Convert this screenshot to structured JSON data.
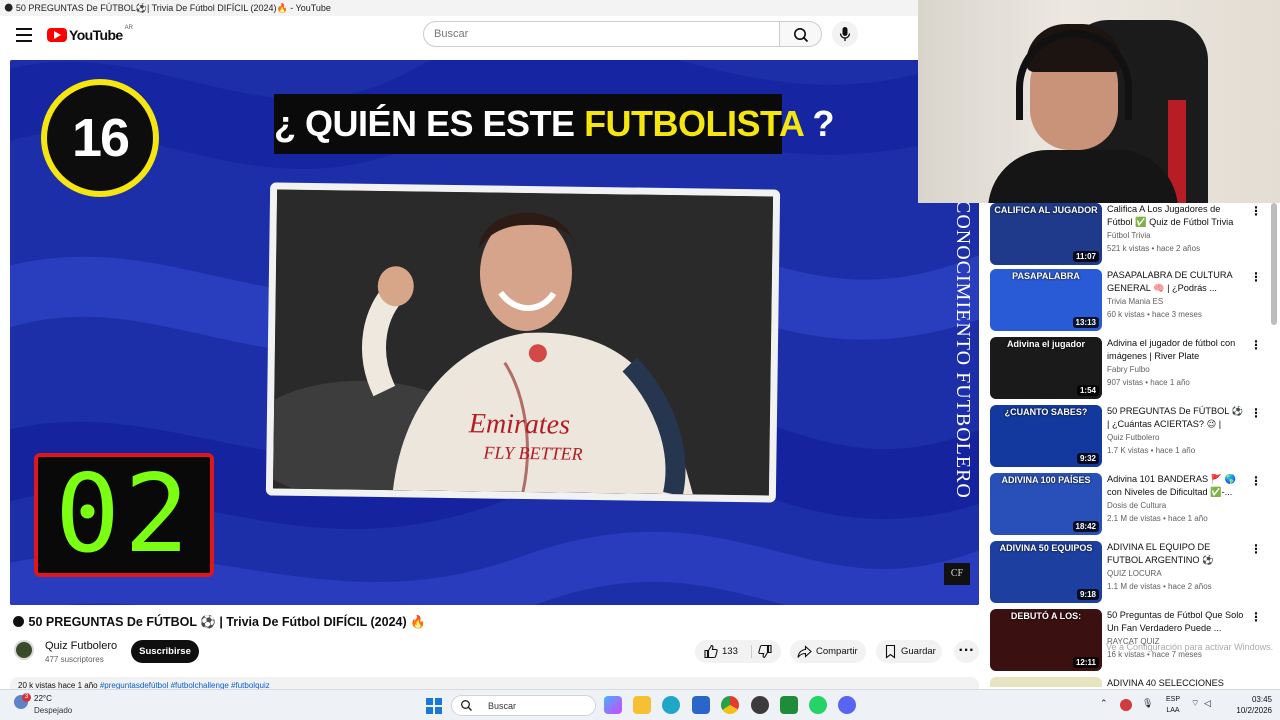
{
  "window": {
    "title": "🌑 50 PREGUNTAS De FÚTBOL⚽| Trivia De Fútbol DIFÍCIL (2024)🔥 - YouTube"
  },
  "masthead": {
    "logo_text": "YouTube",
    "country_code": "AR",
    "search_placeholder": "Buscar"
  },
  "player": {
    "question_number": "16",
    "question_prefix": "¿ QUIÉN ES ESTE ",
    "question_highlight": "FUTBOLISTA",
    "question_suffix": " ?",
    "timer": "02",
    "side_text": "CONOCIMIENTO FUTBOLERO",
    "watermark": "CF",
    "jersey_text": "Emirates FLY BETTER"
  },
  "video": {
    "title": "🌑 50 PREGUNTAS De FÚTBOL ⚽ | Trivia De Fútbol DIFÍCIL (2024) 🔥",
    "channel_name": "Quiz Futbolero",
    "subscribers": "477 suscriptores",
    "subscribe_label": "Suscribirse",
    "likes": "133",
    "share_label": "Compartir",
    "save_label": "Guardar",
    "description_views": "20 k vistas  hace 1 año",
    "description_tags": "#preguntasdefútbol #futbolchallenge #futbolquiz"
  },
  "recommendations": [
    {
      "title": "Califica A Los Jugadores de Fútbol ✅ Quiz de Fútbol Trivia",
      "channel": "Fútbol Trivia",
      "meta": "521 k vistas • hace 2 años",
      "duration": "11:07",
      "thumb_title": "CALIFICA AL JUGADOR",
      "thumb_color": "#1f3a8a"
    },
    {
      "title": "PASAPALABRA DE CULTURA GENERAL 🧠 | ¿Podrás ...",
      "channel": "Trivia Mania ES",
      "meta": "60 k vistas • hace 3 meses",
      "duration": "13:13",
      "thumb_title": "PASAPALABRA",
      "thumb_color": "#2a5bd7"
    },
    {
      "title": "Adivina el jugador de fútbol con imágenes | River Plate",
      "channel": "Fabry Fulbo",
      "meta": "907 vistas • hace 1 año",
      "duration": "1:54",
      "thumb_title": "Adivina el jugador",
      "thumb_color": "#1a1a1a"
    },
    {
      "title": "50 PREGUNTAS De FÚTBOL ⚽ | ¿Cuántas ACIERTAS? 😉 | Trivi...",
      "channel": "Quiz Futbolero",
      "meta": "1.7 K vistas • hace 1 año",
      "duration": "9:32",
      "thumb_title": "¿CUANTO SABES?",
      "thumb_color": "#14399e"
    },
    {
      "title": "Adivina 101 BANDERAS 🚩 🌎 con Niveles de Dificultad ✅-...",
      "channel": "Dosis de Cultura",
      "meta": "2.1 M de vistas • hace 1 año",
      "duration": "18:42",
      "thumb_title": "ADIVINA 100 PAÍSES",
      "thumb_color": "#2950b8"
    },
    {
      "title": "ADIVINA EL EQUIPO DE FUTBOL ARGENTINO ⚽ ADIVINA EL ...",
      "channel": "QUIZ LOCURA",
      "meta": "1.1 M de vistas • hace 2 años",
      "duration": "9:18",
      "thumb_title": "ADIVINA 50 EQUIPOS",
      "thumb_color": "#1d3fa0"
    },
    {
      "title": "50 Preguntas de Fútbol Que Solo Un Fan Verdadero Puede ...",
      "channel": "RAYCAT QUIZ",
      "meta": "16 k vistas • hace 7 meses",
      "duration": "12:11",
      "thumb_title": "DEBUTÓ A LOS:",
      "thumb_color": "#3a1010"
    },
    {
      "title": "ADIVINA 40 SELECCIONES",
      "channel": "",
      "meta": "",
      "duration": "",
      "thumb_title": "",
      "thumb_color": "#e8e4c0"
    }
  ],
  "activate_windows": "Ve a Configuración para activar Windows.",
  "taskbar": {
    "temperature": "22°C",
    "weather": "Despejado",
    "weather_badge": "3",
    "search_label": "Buscar",
    "lang_1": "ESP",
    "lang_2": "LAA",
    "time": "03:45",
    "date": "10/2/2026"
  },
  "colors": {
    "player_blue": "#1c2fa8",
    "timer_green": "#7bff12",
    "question_yellow": "#f5e60f",
    "youtube_red": "#ff0000"
  }
}
